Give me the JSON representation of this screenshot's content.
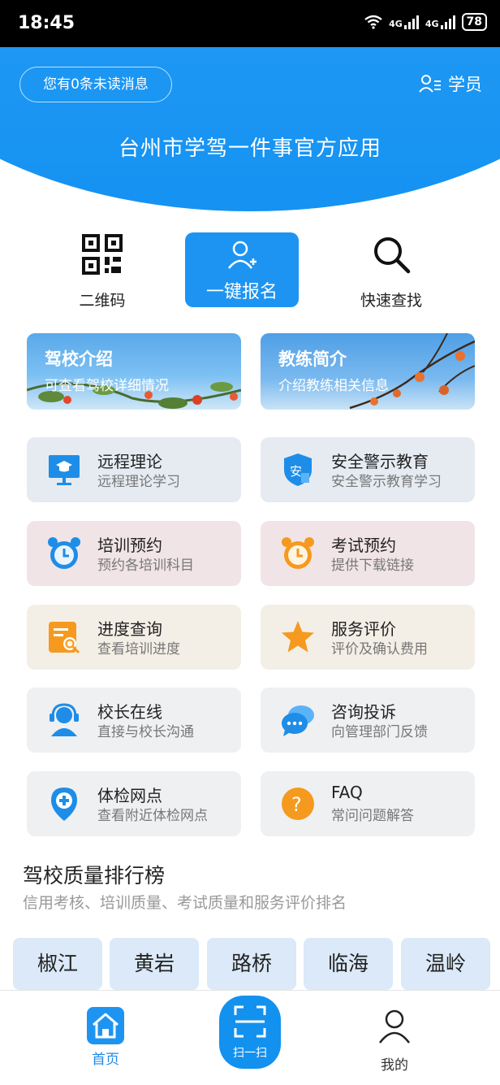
{
  "status_bar": {
    "time": "18:45",
    "network_1": "4G",
    "network_2": "4G",
    "battery": "78"
  },
  "header": {
    "unread_message": "您有0条未读消息",
    "role_label": "学员",
    "app_title": "台州市学驾一件事官方应用",
    "color": "#1592f2"
  },
  "quick_actions": {
    "qrcode_label": "二维码",
    "signup_label": "一键报名",
    "search_label": "快速查找"
  },
  "banners": [
    {
      "title": "驾校介绍",
      "subtitle": "可查看驾校详细情况"
    },
    {
      "title": "教练简介",
      "subtitle": "介绍教练相关信息"
    }
  ],
  "services": [
    {
      "title": "远程理论",
      "subtitle": "远程理论学习",
      "icon": "training-screen-icon"
    },
    {
      "title": "安全警示教育",
      "subtitle": "安全警示教育学习",
      "icon": "safety-shield-icon"
    },
    {
      "title": "培训预约",
      "subtitle": "预约各培训科目",
      "icon": "alarm-clock-blue-icon"
    },
    {
      "title": "考试预约",
      "subtitle": "提供下载链接",
      "icon": "alarm-clock-orange-icon"
    },
    {
      "title": "进度查询",
      "subtitle": "查看培训进度",
      "icon": "progress-search-icon"
    },
    {
      "title": "服务评价",
      "subtitle": "评价及确认费用",
      "icon": "star-icon"
    },
    {
      "title": "校长在线",
      "subtitle": "直接与校长沟通",
      "icon": "headset-icon"
    },
    {
      "title": "咨询投诉",
      "subtitle": "向管理部门反馈",
      "icon": "chat-bubbles-icon"
    },
    {
      "title": "体检网点",
      "subtitle": "查看附近体检网点",
      "icon": "medical-location-icon"
    },
    {
      "title": "FAQ",
      "subtitle": "常问问题解答",
      "icon": "question-icon"
    }
  ],
  "ranking": {
    "title": "驾校质量排行榜",
    "subtitle": "信用考核、培训质量、考试质量和服务评价排名",
    "cities": [
      "椒江",
      "黄岩",
      "路桥",
      "临海",
      "温岭"
    ]
  },
  "bottom_nav": {
    "home": "首页",
    "scan": "扫一扫",
    "profile": "我的"
  }
}
